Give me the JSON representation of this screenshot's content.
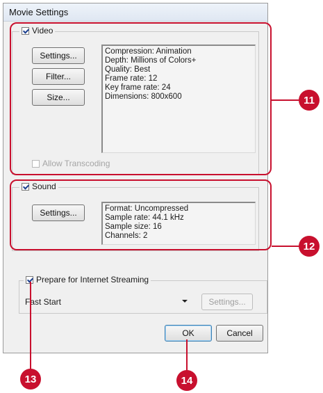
{
  "dialog": {
    "title": "Movie Settings",
    "video": {
      "label": "Video",
      "checked": true,
      "buttons": [
        "Settings...",
        "Filter...",
        "Size..."
      ],
      "info_lines": [
        "Compression: Animation",
        "Depth: Millions of Colors+",
        "Quality: Best",
        "Frame rate: 12",
        "Key frame rate: 24",
        "Dimensions: 800x600"
      ],
      "allow_transcoding": "Allow Transcoding"
    },
    "sound": {
      "label": "Sound",
      "checked": true,
      "settings_button": "Settings...",
      "info_lines": [
        "Format: Uncompressed",
        "Sample rate: 44.1 kHz",
        "Sample size: 16",
        "Channels: 2"
      ]
    },
    "streaming": {
      "label": "Prepare for Internet Streaming",
      "checked": true,
      "selected": "Fast Start",
      "settings_button": "Settings..."
    },
    "ok_button": "OK",
    "cancel_button": "Cancel"
  },
  "callouts": [
    "11",
    "12",
    "13",
    "14"
  ],
  "colors": {
    "callout": "#c8102e",
    "dialog_bg": "#f0f0f0"
  }
}
